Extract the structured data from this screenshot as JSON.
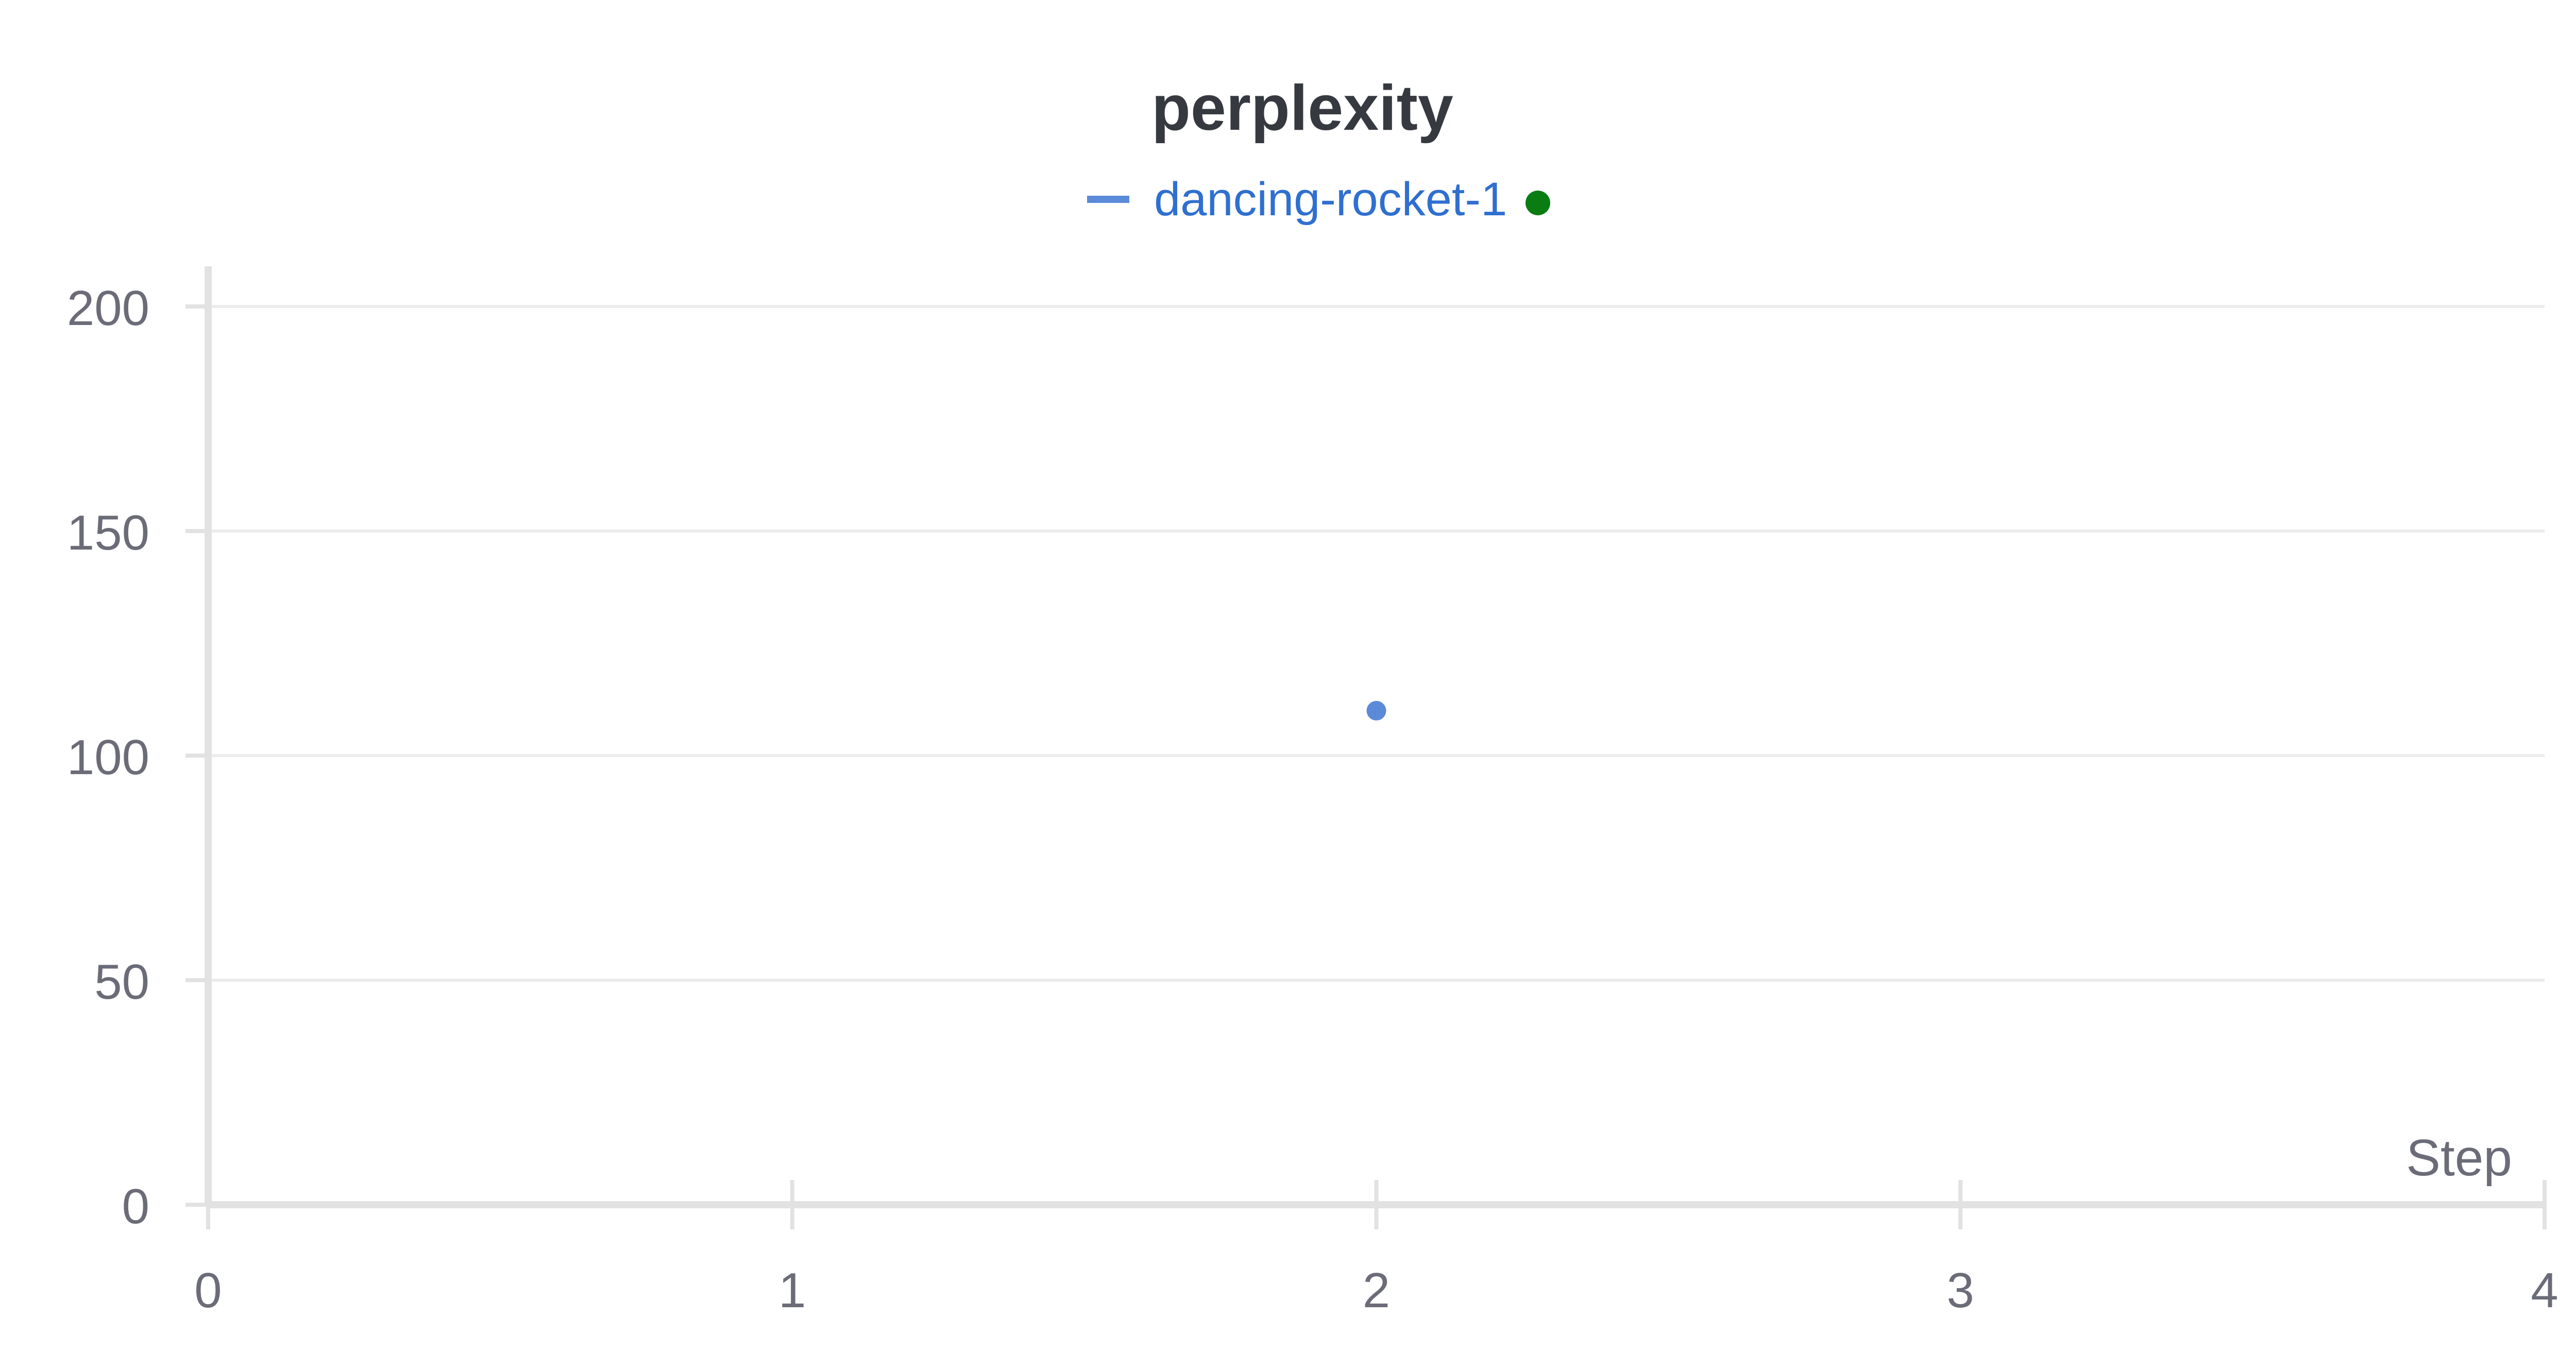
{
  "chart_data": {
    "type": "scatter",
    "title": "perplexity",
    "xlabel": "Step",
    "ylabel": "",
    "xlim": [
      0,
      4
    ],
    "ylim": [
      0,
      220
    ],
    "x_ticks": [
      "0",
      "1",
      "2",
      "3",
      "4"
    ],
    "y_ticks": [
      "0",
      "50",
      "100",
      "150",
      "200"
    ],
    "grid": "horizontal",
    "legend_position": "top-center",
    "series": [
      {
        "name": "dancing-rocket-1",
        "color": "#5b8ad9",
        "points": [
          {
            "x": 2,
            "y": 110
          }
        ]
      }
    ],
    "legend_status_color": "#0a7d12"
  },
  "colors": {
    "grid": "#ececec",
    "axis": "#e2e2e2",
    "tick_text": "#6b6c78",
    "title_text": "#363a40",
    "legend_text": "#2f6fd0"
  }
}
